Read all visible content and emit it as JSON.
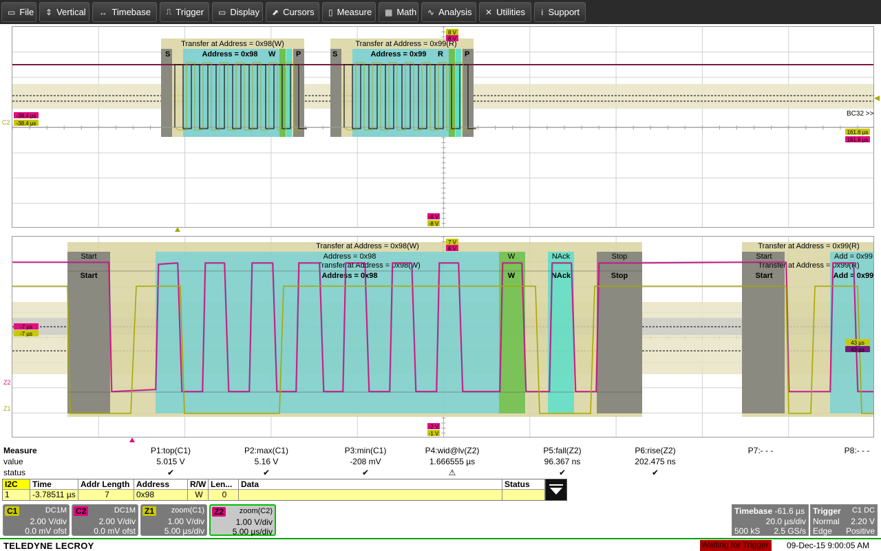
{
  "menu": {
    "items": [
      {
        "label": "File",
        "icon": "file-icon",
        "glyph": "▭"
      },
      {
        "label": "Vertical",
        "icon": "vertical-icon",
        "glyph": "⇕"
      },
      {
        "label": "Timebase",
        "icon": "timebase-icon",
        "glyph": "↔"
      },
      {
        "label": "Trigger",
        "icon": "trigger-icon",
        "glyph": "⎍"
      },
      {
        "label": "Display",
        "icon": "display-icon",
        "glyph": "▭"
      },
      {
        "label": "Cursors",
        "icon": "cursors-icon",
        "glyph": "⬈"
      },
      {
        "label": "Measure",
        "icon": "measure-icon",
        "glyph": "▯"
      },
      {
        "label": "Math",
        "icon": "math-icon",
        "glyph": "▦"
      },
      {
        "label": "Analysis",
        "icon": "analysis-icon",
        "glyph": "∿"
      },
      {
        "label": "Utilities",
        "icon": "utilities-icon",
        "glyph": "✕"
      },
      {
        "label": "Support",
        "icon": "support-icon",
        "glyph": "i"
      }
    ]
  },
  "upper": {
    "frame1_title": "Transfer at Address = 0x98(W)",
    "frame1_addr": "Address = 0x98",
    "frame2_title": "Transfer at Address = 0x99(R)",
    "frame2_addr": "Address = 0x99",
    "s": "S",
    "p": "P",
    "w": "W",
    "r": "R",
    "ch_c2": "C2",
    "cur_left_a": "-38.4 µs",
    "cur_left_b": "-38.4 µs",
    "cur_right_a": "161.6 µs",
    "cur_right_b": "161.6 µs",
    "volt_top_a": "8 V",
    "volt_top_b": "8 V",
    "volt_bot_a": "-8 V",
    "volt_bot_b": "-8 V",
    "offscreen": "BC32 >>"
  },
  "lower": {
    "t1": "Transfer at Address = 0x98(W)",
    "t2": "Transfer at Address = 0x98(W)",
    "addr1": "Address = 0x98",
    "addr2": "Address = 0x98",
    "start": "Start",
    "w": "W",
    "nack": "NAck",
    "stop": "Stop",
    "t3": "Transfer at Address = 0x99(R)",
    "t4": "Transfer at Address = 0x99(R)",
    "add": "Add = 0x99",
    "z1": "Z1",
    "z2": "Z2",
    "cur_left_a": "-7 µs",
    "cur_left_b": "-7 µs",
    "cur_right_a": "43 µs",
    "cur_right_b": "43 µs",
    "volt_top_a": "7 V",
    "volt_top_b": "6 V",
    "volt_bot_a": "-2 V",
    "volt_bot_b": "-1 V"
  },
  "measure": {
    "row_labels": [
      "Measure",
      "value",
      "status"
    ],
    "cols": [
      {
        "name": "P1:top(C1)",
        "value": "5.015 V",
        "status": "✔"
      },
      {
        "name": "P2:max(C1)",
        "value": "5.16 V",
        "status": "✔"
      },
      {
        "name": "P3:min(C1)",
        "value": "-208 mV",
        "status": "✔"
      },
      {
        "name": "P4:wid@lv(Z2)",
        "value": "1.666555 µs",
        "status": "⚠"
      },
      {
        "name": "P5:fall(Z2)",
        "value": "96.367 ns",
        "status": "✔"
      },
      {
        "name": "P6:rise(Z2)",
        "value": "202.475 ns",
        "status": "✔"
      },
      {
        "name": "P7:- - -",
        "value": "",
        "status": ""
      },
      {
        "name": "P8:- - -",
        "value": "",
        "status": ""
      }
    ]
  },
  "decode": {
    "headers": [
      "I2C",
      "Time",
      "Addr Length",
      "Address",
      "R/W",
      "Len...",
      "Data",
      "Status"
    ],
    "row": [
      "1",
      "-3.78511 µs",
      "7",
      "0x98",
      "W",
      "0",
      "",
      ""
    ]
  },
  "channels": [
    {
      "tag": "C1",
      "mode": "DC1M",
      "l2": "2.00 V/div",
      "l3": "0.0 mV ofst",
      "color": "#c8c800"
    },
    {
      "tag": "C2",
      "mode": "DC1M",
      "l2": "2.00 V/div",
      "l3": "0.0 mV ofst",
      "color": "#e0007f"
    },
    {
      "tag": "Z1",
      "mode": "zoom(C1)",
      "l2": "1.00 V/div",
      "l3": "5.00 µs/div",
      "color": "#c8c800"
    },
    {
      "tag": "Z2",
      "mode": "zoom(C2)",
      "l2": "1.00 V/div",
      "l3": "5.00 µs/div",
      "color": "#e0007f"
    }
  ],
  "timebase": {
    "title": "Timebase",
    "delay": "-61.6 µs",
    "div": "20.0 µs/div",
    "samples": "500 kS",
    "rate": "2.5 GS/s"
  },
  "trigger": {
    "title": "Trigger",
    "src": "C1 DC",
    "mode": "Normal",
    "level": "2.20 V",
    "type": "Edge",
    "slope": "Positive"
  },
  "status": {
    "brand": "TELEDYNE LECROY",
    "waiting": "Waiting for Trigger",
    "datetime": "09-Dec-15 9:00:05 AM"
  },
  "colors": {
    "c1": "#a8a800",
    "c2": "#e0107f",
    "tan": "#d8d4a0",
    "cyan": "#6ed0d8",
    "green": "#70c050",
    "grey": "#8a8a80"
  }
}
